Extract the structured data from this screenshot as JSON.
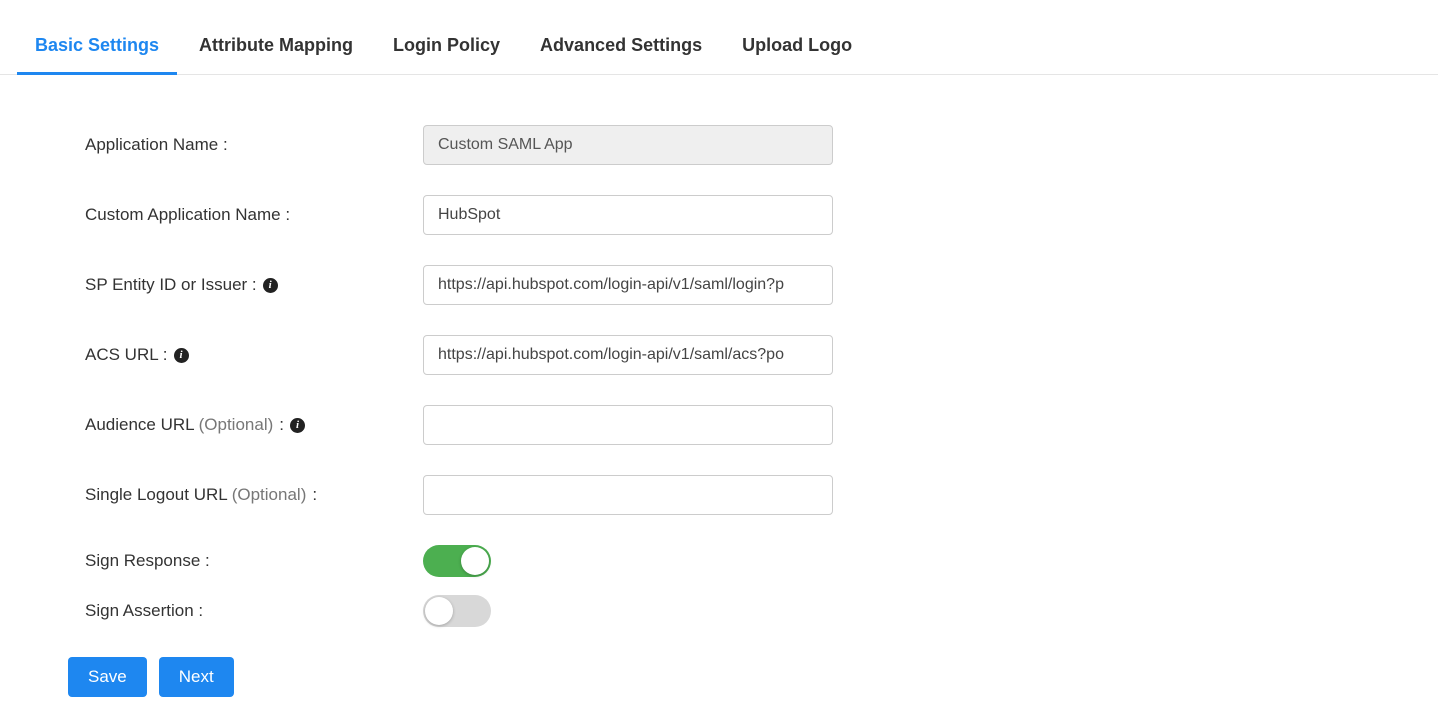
{
  "tabs": [
    {
      "label": "Basic Settings",
      "active": true
    },
    {
      "label": "Attribute Mapping",
      "active": false
    },
    {
      "label": "Login Policy",
      "active": false
    },
    {
      "label": "Advanced Settings",
      "active": false
    },
    {
      "label": "Upload Logo",
      "active": false
    }
  ],
  "labels": {
    "app_name": "Application Name :",
    "custom_app_name": "Custom Application Name :",
    "sp_entity": "SP Entity ID or Issuer :",
    "acs_url": "ACS URL :",
    "audience_url_pre": "Audience URL",
    "audience_url_post": " :",
    "logout_url_pre": "Single Logout URL",
    "logout_url_post": " :",
    "optional": "(Optional)",
    "sign_response": "Sign Response :",
    "sign_assertion": "Sign Assertion :"
  },
  "values": {
    "app_name": "Custom SAML App",
    "custom_app_name": "HubSpot",
    "sp_entity": "https://api.hubspot.com/login-api/v1/saml/login?p",
    "acs_url": "https://api.hubspot.com/login-api/v1/saml/acs?po",
    "audience_url": "",
    "logout_url": "",
    "sign_response": true,
    "sign_assertion": false
  },
  "buttons": {
    "save": "Save",
    "next": "Next"
  },
  "info_glyph": "i"
}
